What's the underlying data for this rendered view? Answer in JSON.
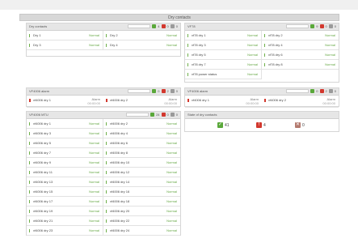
{
  "page": {
    "title": "Dry contacts"
  },
  "panels": {
    "dry": {
      "title": "Dry contacts",
      "tools": {
        "ok": "4",
        "alarm": "0",
        "off": "0"
      },
      "items": [
        {
          "label": "Dry 1",
          "status": "Normal",
          "alarm": false
        },
        {
          "label": "Dry 2",
          "status": "Normal",
          "alarm": false
        },
        {
          "label": "Dry 3",
          "status": "Normal",
          "alarm": false
        },
        {
          "label": "Dry 4",
          "status": "Normal",
          "alarm": false
        }
      ]
    },
    "vfr": {
      "title": "VF78",
      "tools": {
        "ok": "9",
        "alarm": "0",
        "off": "0"
      },
      "items": [
        {
          "label": "vf78 dry 1",
          "status": "Normal",
          "alarm": false
        },
        {
          "label": "vf78 dry 2",
          "status": "Normal",
          "alarm": false
        },
        {
          "label": "vf78 dry 3",
          "status": "Normal",
          "alarm": false
        },
        {
          "label": "vf78 dry 4",
          "status": "Normal",
          "alarm": false
        },
        {
          "label": "vf78 dry 5",
          "status": "Normal",
          "alarm": false
        },
        {
          "label": "vf78 dry 6",
          "status": "Normal",
          "alarm": false
        },
        {
          "label": "vf78 dry 7",
          "status": "Normal",
          "alarm": false
        },
        {
          "label": "vf78 dry 8",
          "status": "Normal",
          "alarm": false
        },
        {
          "label": "vf78 power status",
          "status": "Normal",
          "alarm": false
        }
      ]
    },
    "al1": {
      "title": "VF4006 alarm",
      "tools": {
        "ok": "0",
        "alarm": "2",
        "off": "0"
      },
      "items": [
        {
          "label": "vf4006 dry 1",
          "meta1": "Alarm",
          "meta2": "00:00:00"
        },
        {
          "label": "vf4006 dry 2",
          "meta1": "Alarm",
          "meta2": "00:00:00"
        }
      ]
    },
    "al2": {
      "title": "VF4006 alarm",
      "tools": {
        "ok": "0",
        "alarm": "2",
        "off": "0"
      },
      "items": [
        {
          "label": "vf4006 dry 1",
          "meta1": "Alarm",
          "meta2": "00:00:00"
        },
        {
          "label": "vf4006 dry 2",
          "meta1": "Alarm",
          "meta2": "00:00:00"
        }
      ]
    },
    "big": {
      "title": "VF4006 MTU",
      "tools": {
        "ok": "24",
        "alarm": "0",
        "off": "0"
      },
      "items": [
        {
          "label": "vf4006 dry 1",
          "status": "Normal",
          "alarm": false
        },
        {
          "label": "vf4006 dry 2",
          "status": "Normal",
          "alarm": false
        },
        {
          "label": "vf4006 dry 3",
          "status": "Normal",
          "alarm": false
        },
        {
          "label": "vf4006 dry 4",
          "status": "Normal",
          "alarm": false
        },
        {
          "label": "vf4006 dry 5",
          "status": "Normal",
          "alarm": false
        },
        {
          "label": "vf4006 dry 6",
          "status": "Normal",
          "alarm": false
        },
        {
          "label": "vf4006 dry 7",
          "status": "Normal",
          "alarm": false
        },
        {
          "label": "vf4006 dry 8",
          "status": "Normal",
          "alarm": false
        },
        {
          "label": "vf4006 dry 9",
          "status": "Normal",
          "alarm": false
        },
        {
          "label": "vf4006 dry 10",
          "status": "Normal",
          "alarm": false
        },
        {
          "label": "vf4006 dry 11",
          "status": "Normal",
          "alarm": false
        },
        {
          "label": "vf4006 dry 12",
          "status": "Normal",
          "alarm": false
        },
        {
          "label": "vf4006 dry 13",
          "status": "Normal",
          "alarm": false
        },
        {
          "label": "vf4006 dry 14",
          "status": "Normal",
          "alarm": false
        },
        {
          "label": "vf4006 dry 15",
          "status": "Normal",
          "alarm": false
        },
        {
          "label": "vf4006 dry 16",
          "status": "Normal",
          "alarm": false
        },
        {
          "label": "vf4006 dry 17",
          "status": "Normal",
          "alarm": false
        },
        {
          "label": "vf4006 dry 18",
          "status": "Normal",
          "alarm": false
        },
        {
          "label": "vf4006 dry 19",
          "status": "Normal",
          "alarm": false
        },
        {
          "label": "vf4006 dry 20",
          "status": "Normal",
          "alarm": false
        },
        {
          "label": "vf4006 dry 21",
          "status": "Normal",
          "alarm": false
        },
        {
          "label": "vf4006 dry 22",
          "status": "Normal",
          "alarm": false
        },
        {
          "label": "vf4006 dry 23",
          "status": "Normal",
          "alarm": false
        },
        {
          "label": "vf4006 dry 24",
          "status": "Normal",
          "alarm": false
        }
      ]
    },
    "state": {
      "title": "State of dry contacts",
      "items": [
        {
          "kind": "green",
          "glyph": "✓",
          "count": "41"
        },
        {
          "kind": "red",
          "glyph": "!",
          "count": "4"
        },
        {
          "kind": "gray",
          "glyph": "✕",
          "count": "0"
        }
      ]
    }
  }
}
